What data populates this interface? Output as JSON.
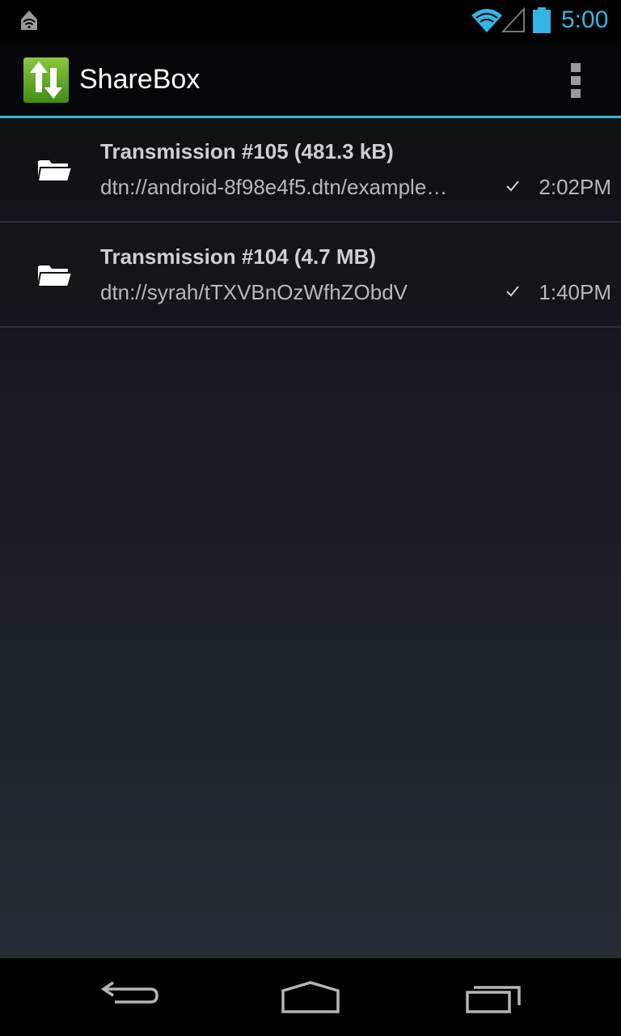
{
  "status_bar": {
    "time": "5:00",
    "accent_color": "#33b5e5",
    "icons": [
      "notification-icon",
      "wifi-icon",
      "signal-icon",
      "battery-icon"
    ]
  },
  "action_bar": {
    "title": "ShareBox",
    "app_icon": "sharebox-app-icon",
    "overflow_icon": "overflow-menu-icon"
  },
  "transmissions": [
    {
      "title": "Transmission #105 (481.3 kB)",
      "subtitle": "dtn://android-8f98e4f5.dtn/example…",
      "time": "2:02PM",
      "status_icon": "check-icon"
    },
    {
      "title": "Transmission #104 (4.7 MB)",
      "subtitle": "dtn://syrah/tTXVBnOzWfhZObdV",
      "time": "1:40PM",
      "status_icon": "check-icon"
    }
  ],
  "nav_bar": {
    "icons": [
      "back-icon",
      "home-icon",
      "recents-icon"
    ]
  }
}
